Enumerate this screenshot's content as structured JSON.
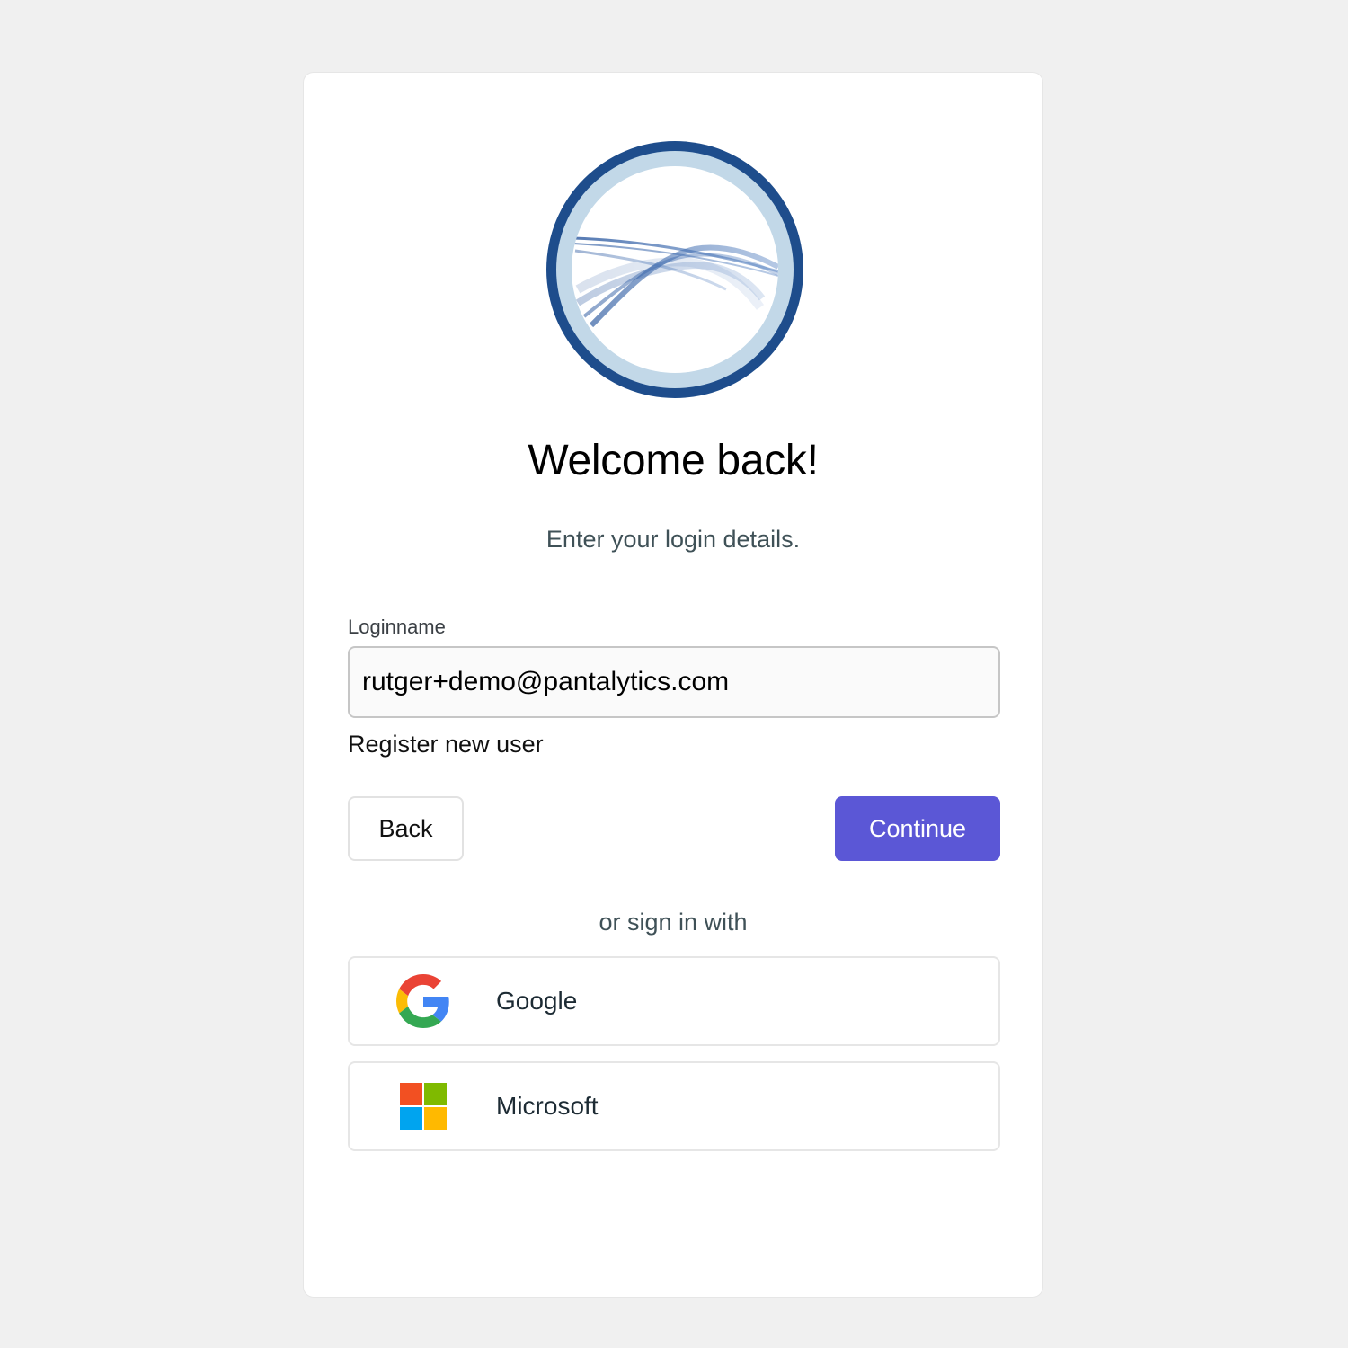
{
  "login": {
    "title": "Welcome back!",
    "subtitle": "Enter your login details.",
    "loginname_label": "Loginname",
    "loginname_value": "rutger+demo@pantalytics.com",
    "register_link": "Register new user",
    "back_button": "Back",
    "continue_button": "Continue",
    "divider_text": "or sign in with"
  },
  "providers": [
    {
      "label": "Google",
      "icon": "google-icon"
    },
    {
      "label": "Microsoft",
      "icon": "microsoft-icon"
    }
  ],
  "colors": {
    "background": "#f0f0f0",
    "card": "#ffffff",
    "primary_button": "#5b57d6",
    "logo_ring_dark": "#1e4d8c",
    "logo_ring_light": "#c2d8e8"
  }
}
